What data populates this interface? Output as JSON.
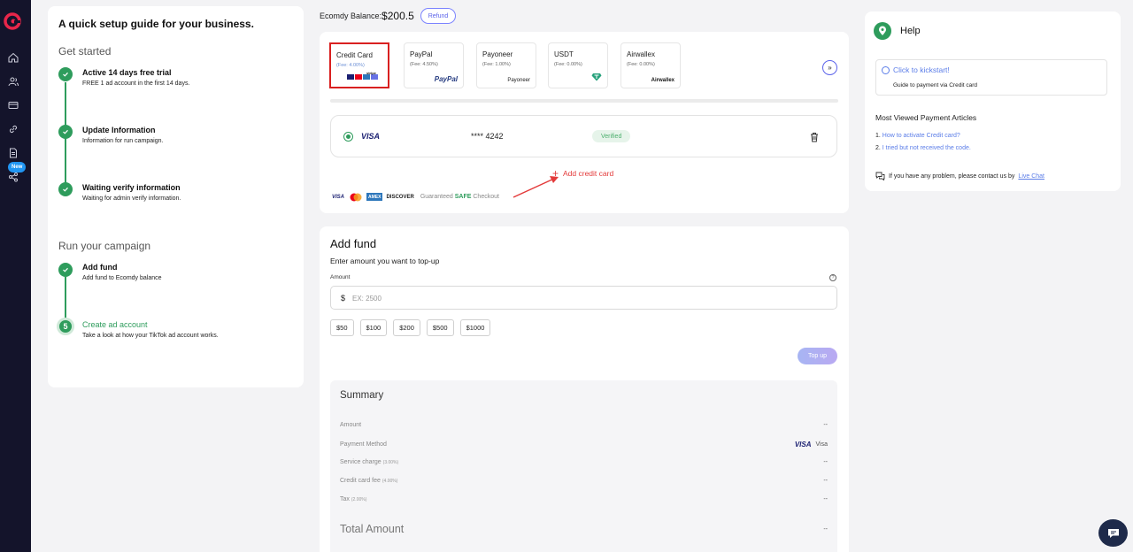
{
  "colors": {
    "sidebar_bg": "#14142b",
    "accent_green": "#2e9c5c",
    "accent_blue": "#5b63ea",
    "link_blue": "#5b7de8",
    "danger_red": "#e33a3a",
    "new_badge": "#2196f3"
  },
  "sidebar": {
    "logo_icon": "ecomdy-logo-icon",
    "items": [
      {
        "icon": "home-icon"
      },
      {
        "icon": "users-icon"
      },
      {
        "icon": "card-icon"
      },
      {
        "icon": "link-icon"
      },
      {
        "icon": "document-icon"
      },
      {
        "icon": "share-icon",
        "badge": "New"
      }
    ]
  },
  "guide": {
    "title": "A quick setup guide for your business.",
    "section1": "Get started",
    "section2": "Run your campaign",
    "steps": [
      {
        "title": "Active 14 days free trial",
        "desc": "FREE 1 ad account in the first 14 days."
      },
      {
        "title": "Update Information",
        "desc": "Information for run campaign."
      },
      {
        "title": "Waiting verify information",
        "desc": "Waiting for admin verify information."
      },
      {
        "title": "Add fund",
        "desc": "Add fund to Ecomdy balance"
      },
      {
        "title": "Create ad account",
        "desc": "Take a look at how your TikTok ad account works.",
        "number": "5"
      }
    ]
  },
  "balance": {
    "label": "Ecomdy Balance:",
    "value": "$200.5",
    "refund_label": "Refund"
  },
  "payment_methods": [
    {
      "name": "Credit Card",
      "fee": "(Fee: 4.00%)",
      "logo": "stripe"
    },
    {
      "name": "PayPal",
      "fee": "(Fee: 4.50%)",
      "logo": "PayPal"
    },
    {
      "name": "Payoneer",
      "fee": "(Fee: 1.00%)",
      "logo": "Payoneer"
    },
    {
      "name": "USDT",
      "fee": "(Fee: 0.00%)",
      "logo": "tether-icon"
    },
    {
      "name": "Airwallex",
      "fee": "(Fee: 0.00%)",
      "logo": "Airwallex"
    }
  ],
  "next_label": "»",
  "saved_card": {
    "brand": "VISA",
    "number": "**** 4242",
    "status": "Verified"
  },
  "add_card_label": "Add credit card",
  "checkout": {
    "brands": [
      "VISA",
      "MC",
      "AMEX",
      "DISCOVER"
    ],
    "text_before": "Guaranteed",
    "safe": "SAFE",
    "text_after": "Checkout"
  },
  "add_fund": {
    "title": "Add fund",
    "subtitle": "Enter amount you want to top-up",
    "amount_label": "Amount",
    "currency": "$",
    "placeholder": "EX: 2500",
    "presets": [
      "$50",
      "$100",
      "$200",
      "$500",
      "$1000"
    ],
    "topup_label": "Top up"
  },
  "summary": {
    "title": "Summary",
    "rows": [
      {
        "label": "Amount",
        "small": "",
        "value": "--"
      },
      {
        "label": "Payment Method",
        "small": "",
        "value": "Visa",
        "brand": "VISA"
      },
      {
        "label": "Service charge",
        "small": "(3.00%)",
        "value": "--"
      },
      {
        "label": "Credit card fee",
        "small": "(4.00%)",
        "value": "--"
      },
      {
        "label": "Tax",
        "small": "(2.00%)",
        "value": "--"
      }
    ],
    "total_label": "Total Amount",
    "total_value": "--"
  },
  "help": {
    "title": "Help",
    "kickstart_link": "Click to kickstart!",
    "kickstart_desc": "Guide to payment via Credit card",
    "articles_title": "Most Viewed Payment Articles",
    "articles": [
      {
        "num": "1.",
        "label": "How to activate Credit card?"
      },
      {
        "num": "2.",
        "label": "I tried but not received the code."
      }
    ],
    "contact_text": "If you have any problem, please contact us by",
    "contact_link": "Live Chat"
  }
}
